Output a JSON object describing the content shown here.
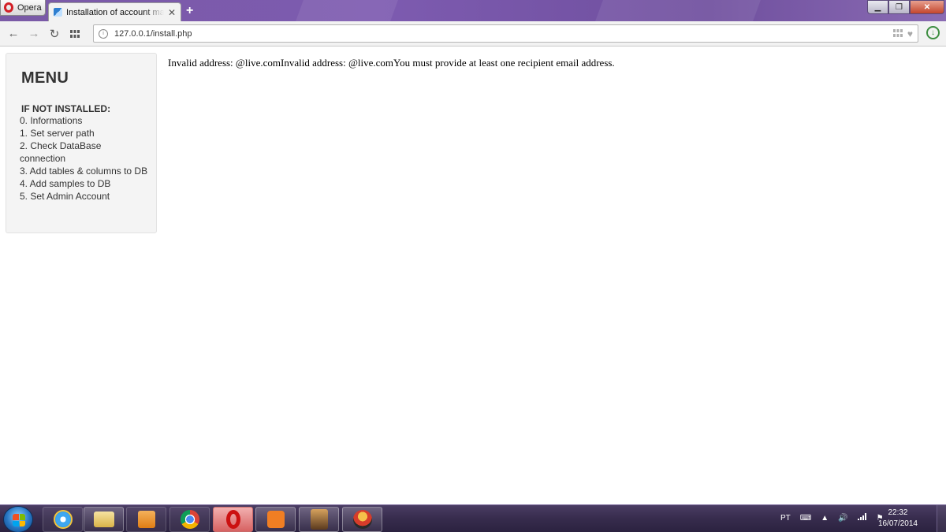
{
  "browser": {
    "opera_button_label": "Opera",
    "active_tab_title": "Installation of account mana",
    "new_tab_label": "+",
    "address_url": "127.0.0.1/install.php"
  },
  "sidebar": {
    "title": "MENU",
    "section_label": "IF NOT INSTALLED:",
    "items": [
      "0. Informations",
      "1. Set server path",
      "2. Check DataBase connection",
      "3. Add tables & columns to DB",
      "4. Add samples to DB",
      "5. Set Admin Account"
    ]
  },
  "main": {
    "message": "Invalid address: @live.comInvalid address: @live.comYou must provide at least one recipient email address."
  },
  "taskbar": {
    "language": "PT",
    "time": "22:32",
    "date": "16/07/2014"
  },
  "icons": [
    "opera-icon",
    "back-icon",
    "forward-icon",
    "reload-icon",
    "speed-dial-icon",
    "site-info-icon",
    "heart-icon",
    "download-icon",
    "windows-start-icon",
    "ie-icon",
    "explorer-icon",
    "media-player-icon",
    "chrome-icon",
    "xampp-icon",
    "volume-icon",
    "network-icon",
    "flag-icon",
    "keyboard-icon"
  ],
  "colors": {
    "titlebar": "#7a5aa6",
    "opera_red": "#d31f26",
    "taskbar": "#372c4d"
  }
}
